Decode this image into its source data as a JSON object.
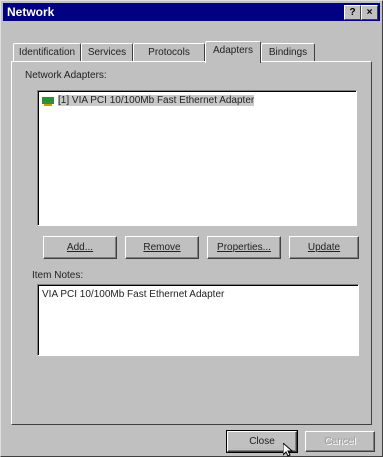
{
  "window": {
    "title": "Network",
    "help_button": "?",
    "close_button": "×"
  },
  "tabs": [
    {
      "label": "Identification",
      "active": false
    },
    {
      "label": "Services",
      "active": false
    },
    {
      "label": "Protocols",
      "active": false
    },
    {
      "label": "Adapters",
      "active": true
    },
    {
      "label": "Bindings",
      "active": false
    }
  ],
  "adapters": {
    "label": "Network Adapters:",
    "items": [
      {
        "text": "[1] VIA PCI 10/100Mb Fast Ethernet Adapter",
        "selected": true,
        "icon": "network-card-icon"
      }
    ]
  },
  "buttons": {
    "add": "Add...",
    "remove": "Remove",
    "properties": "Properties...",
    "update": "Update"
  },
  "notes": {
    "label": "Item Notes:",
    "text": "VIA PCI 10/100Mb Fast Ethernet Adapter"
  },
  "footer": {
    "close": "Close",
    "cancel": "Cancel"
  },
  "colors": {
    "titlebar": "#000080",
    "face": "#c0c0c0",
    "icon_card": "#2f8f3a"
  }
}
